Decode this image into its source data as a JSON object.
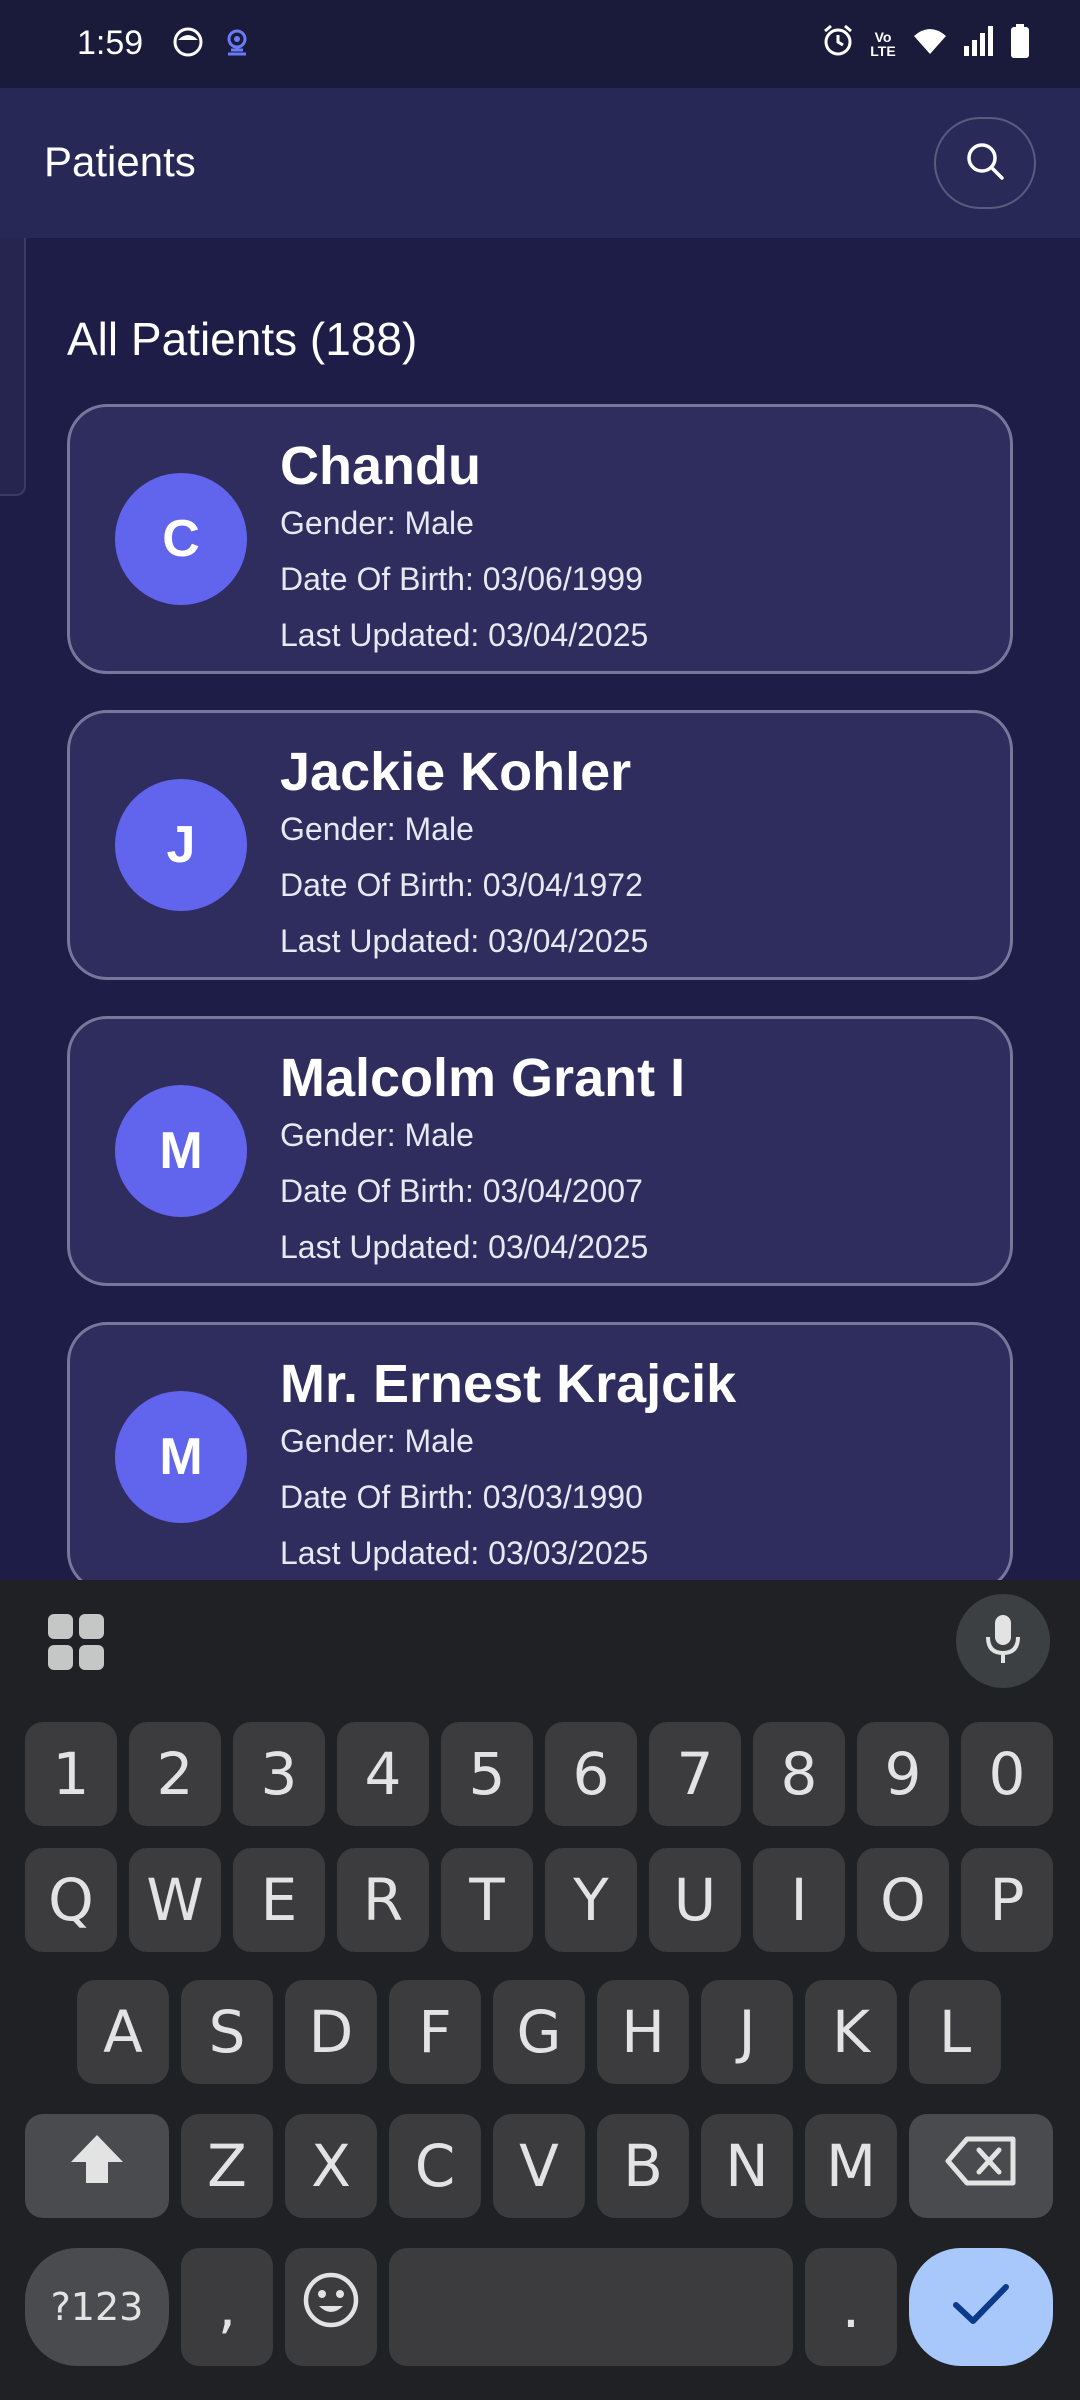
{
  "status_bar": {
    "time": "1:59",
    "left_icons": [
      "face-notification-icon",
      "podcast-notification-icon"
    ],
    "right_icons": [
      "alarm-icon",
      "volte-icon",
      "wifi-icon",
      "signal-icon",
      "battery-icon"
    ],
    "volte_text": "Vo LTE"
  },
  "app_bar": {
    "title": "Patients",
    "search_icon": "search-icon"
  },
  "list": {
    "section_title": "All Patients (188)",
    "patients": [
      {
        "initial": "C",
        "name": "Chandu",
        "gender": "Gender: Male",
        "dob": "Date Of Birth: 03/06/1999",
        "updated": "Last Updated: 03/04/2025"
      },
      {
        "initial": "J",
        "name": "Jackie Kohler",
        "gender": "Gender: Male",
        "dob": "Date Of Birth: 03/04/1972",
        "updated": "Last Updated: 03/04/2025"
      },
      {
        "initial": "M",
        "name": "Malcolm Grant I",
        "gender": "Gender: Male",
        "dob": "Date Of Birth: 03/04/2007",
        "updated": "Last Updated: 03/04/2025"
      },
      {
        "initial": "M",
        "name": "Mr. Ernest Krajcik",
        "gender": "Gender: Male",
        "dob": "Date Of Birth: 03/03/1990",
        "updated": "Last Updated: 03/03/2025"
      }
    ]
  },
  "keyboard": {
    "numbers": [
      "1",
      "2",
      "3",
      "4",
      "5",
      "6",
      "7",
      "8",
      "9",
      "0"
    ],
    "row1": [
      "Q",
      "W",
      "E",
      "R",
      "T",
      "Y",
      "U",
      "I",
      "O",
      "P"
    ],
    "row2": [
      "A",
      "S",
      "D",
      "F",
      "G",
      "H",
      "J",
      "K",
      "L"
    ],
    "row3": [
      "Z",
      "X",
      "C",
      "V",
      "B",
      "N",
      "M"
    ],
    "symbols_label": "?123",
    "comma": ",",
    "period": ".",
    "icons": [
      "apps-grid-icon",
      "mic-icon",
      "shift-icon",
      "backspace-icon",
      "emoji-icon",
      "checkmark-icon"
    ]
  },
  "colors": {
    "background": "#1e1d47",
    "app_bar": "#282856",
    "card": "#2f2d5e",
    "avatar": "#6164ec",
    "keyboard": "#202124",
    "enter_key": "#a8c7fa"
  }
}
